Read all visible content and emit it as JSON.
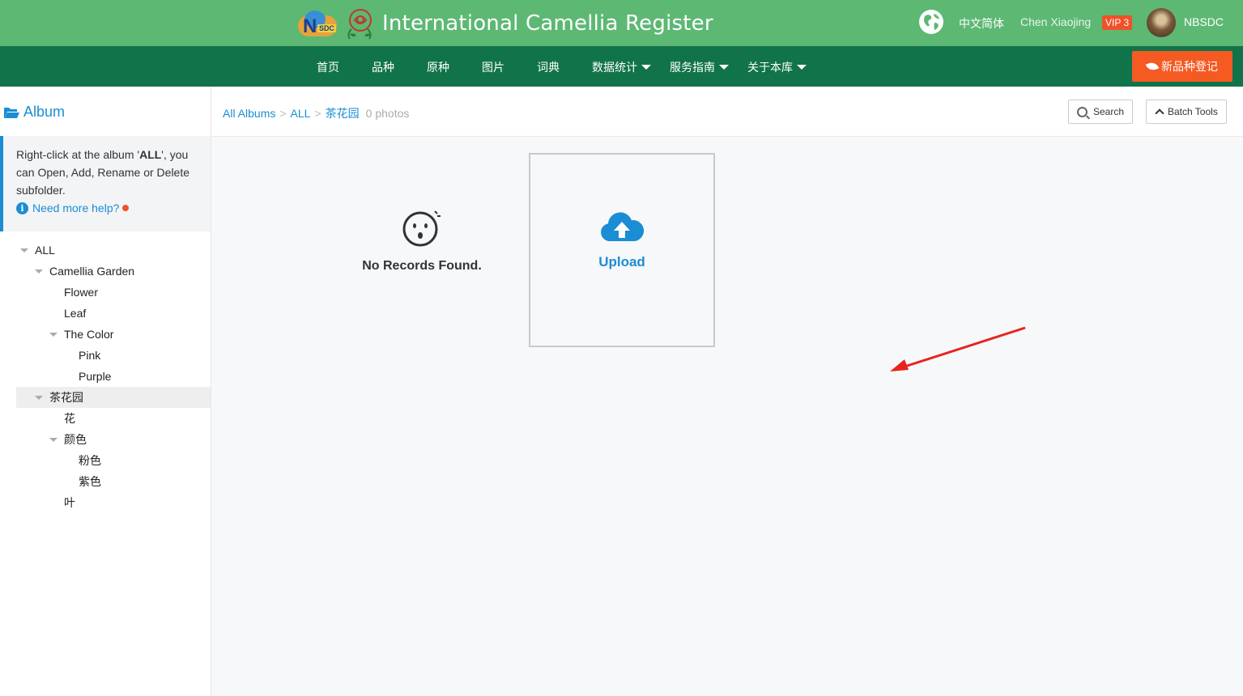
{
  "header": {
    "title": "International Camellia Register",
    "logo_text": "NSDC",
    "language": "中文简体",
    "user": "Chen Xiaojing",
    "vip": "VIP 3",
    "org": "NBSDC"
  },
  "nav": {
    "items": [
      {
        "label": "首页"
      },
      {
        "label": "品种"
      },
      {
        "label": "原种"
      },
      {
        "label": "图片"
      },
      {
        "label": "词典"
      },
      {
        "label": "数据统计"
      },
      {
        "label": "服务指南"
      },
      {
        "label": "关于本库"
      }
    ],
    "register_button": "新品种登记"
  },
  "sidebar": {
    "title": "Album",
    "help": {
      "text_before": "Right-click at the album '",
      "album": "ALL",
      "text_after": "', you can Open, Add, Rename or Delete subfolder.",
      "link": "Need more help?"
    },
    "tree": [
      {
        "label": "ALL",
        "expanded": true,
        "selected": false
      },
      {
        "label": "Camellia Garden",
        "expanded": true,
        "selected": false
      },
      {
        "label": "Flower",
        "expanded": false,
        "selected": false
      },
      {
        "label": "Leaf",
        "expanded": false,
        "selected": false
      },
      {
        "label": "The Color",
        "expanded": true,
        "selected": false
      },
      {
        "label": "Pink",
        "expanded": false,
        "selected": false
      },
      {
        "label": "Purple",
        "expanded": false,
        "selected": false
      },
      {
        "label": "茶花园",
        "expanded": true,
        "selected": true
      },
      {
        "label": "花",
        "expanded": false,
        "selected": false
      },
      {
        "label": "颜色",
        "expanded": true,
        "selected": false
      },
      {
        "label": "粉色",
        "expanded": false,
        "selected": false
      },
      {
        "label": "紫色",
        "expanded": false,
        "selected": false
      },
      {
        "label": "叶",
        "expanded": false,
        "selected": false
      }
    ]
  },
  "main": {
    "breadcrumb": [
      "All Albums",
      "ALL",
      "茶花园"
    ],
    "breadcrumb_separator": ">",
    "photo_count": "0 photos",
    "search_button": "Search",
    "batch_button": "Batch Tools",
    "empty_text": "No Records Found.",
    "upload_label": "Upload"
  },
  "colors": {
    "header_green": "#5db874",
    "nav_green": "#11734a",
    "accent_blue": "#1a8dd4",
    "register_orange": "#f55a23",
    "arrow_red": "#e8231f"
  }
}
